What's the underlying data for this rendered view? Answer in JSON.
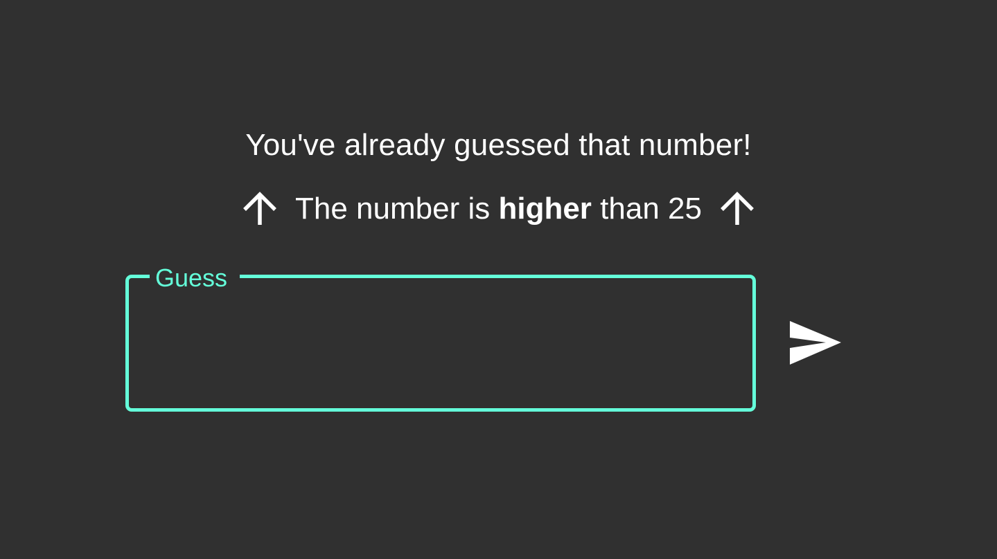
{
  "status": {
    "message": "You've already guessed that number!"
  },
  "hint": {
    "prefix": "The number is ",
    "direction": "higher",
    "suffix": " than 25",
    "icon": "arrow-up-icon"
  },
  "guess_field": {
    "label": "Guess",
    "value": ""
  },
  "submit": {
    "icon": "send-icon"
  },
  "colors": {
    "background": "#303030",
    "accent": "#64ffda",
    "text": "#ffffff"
  }
}
